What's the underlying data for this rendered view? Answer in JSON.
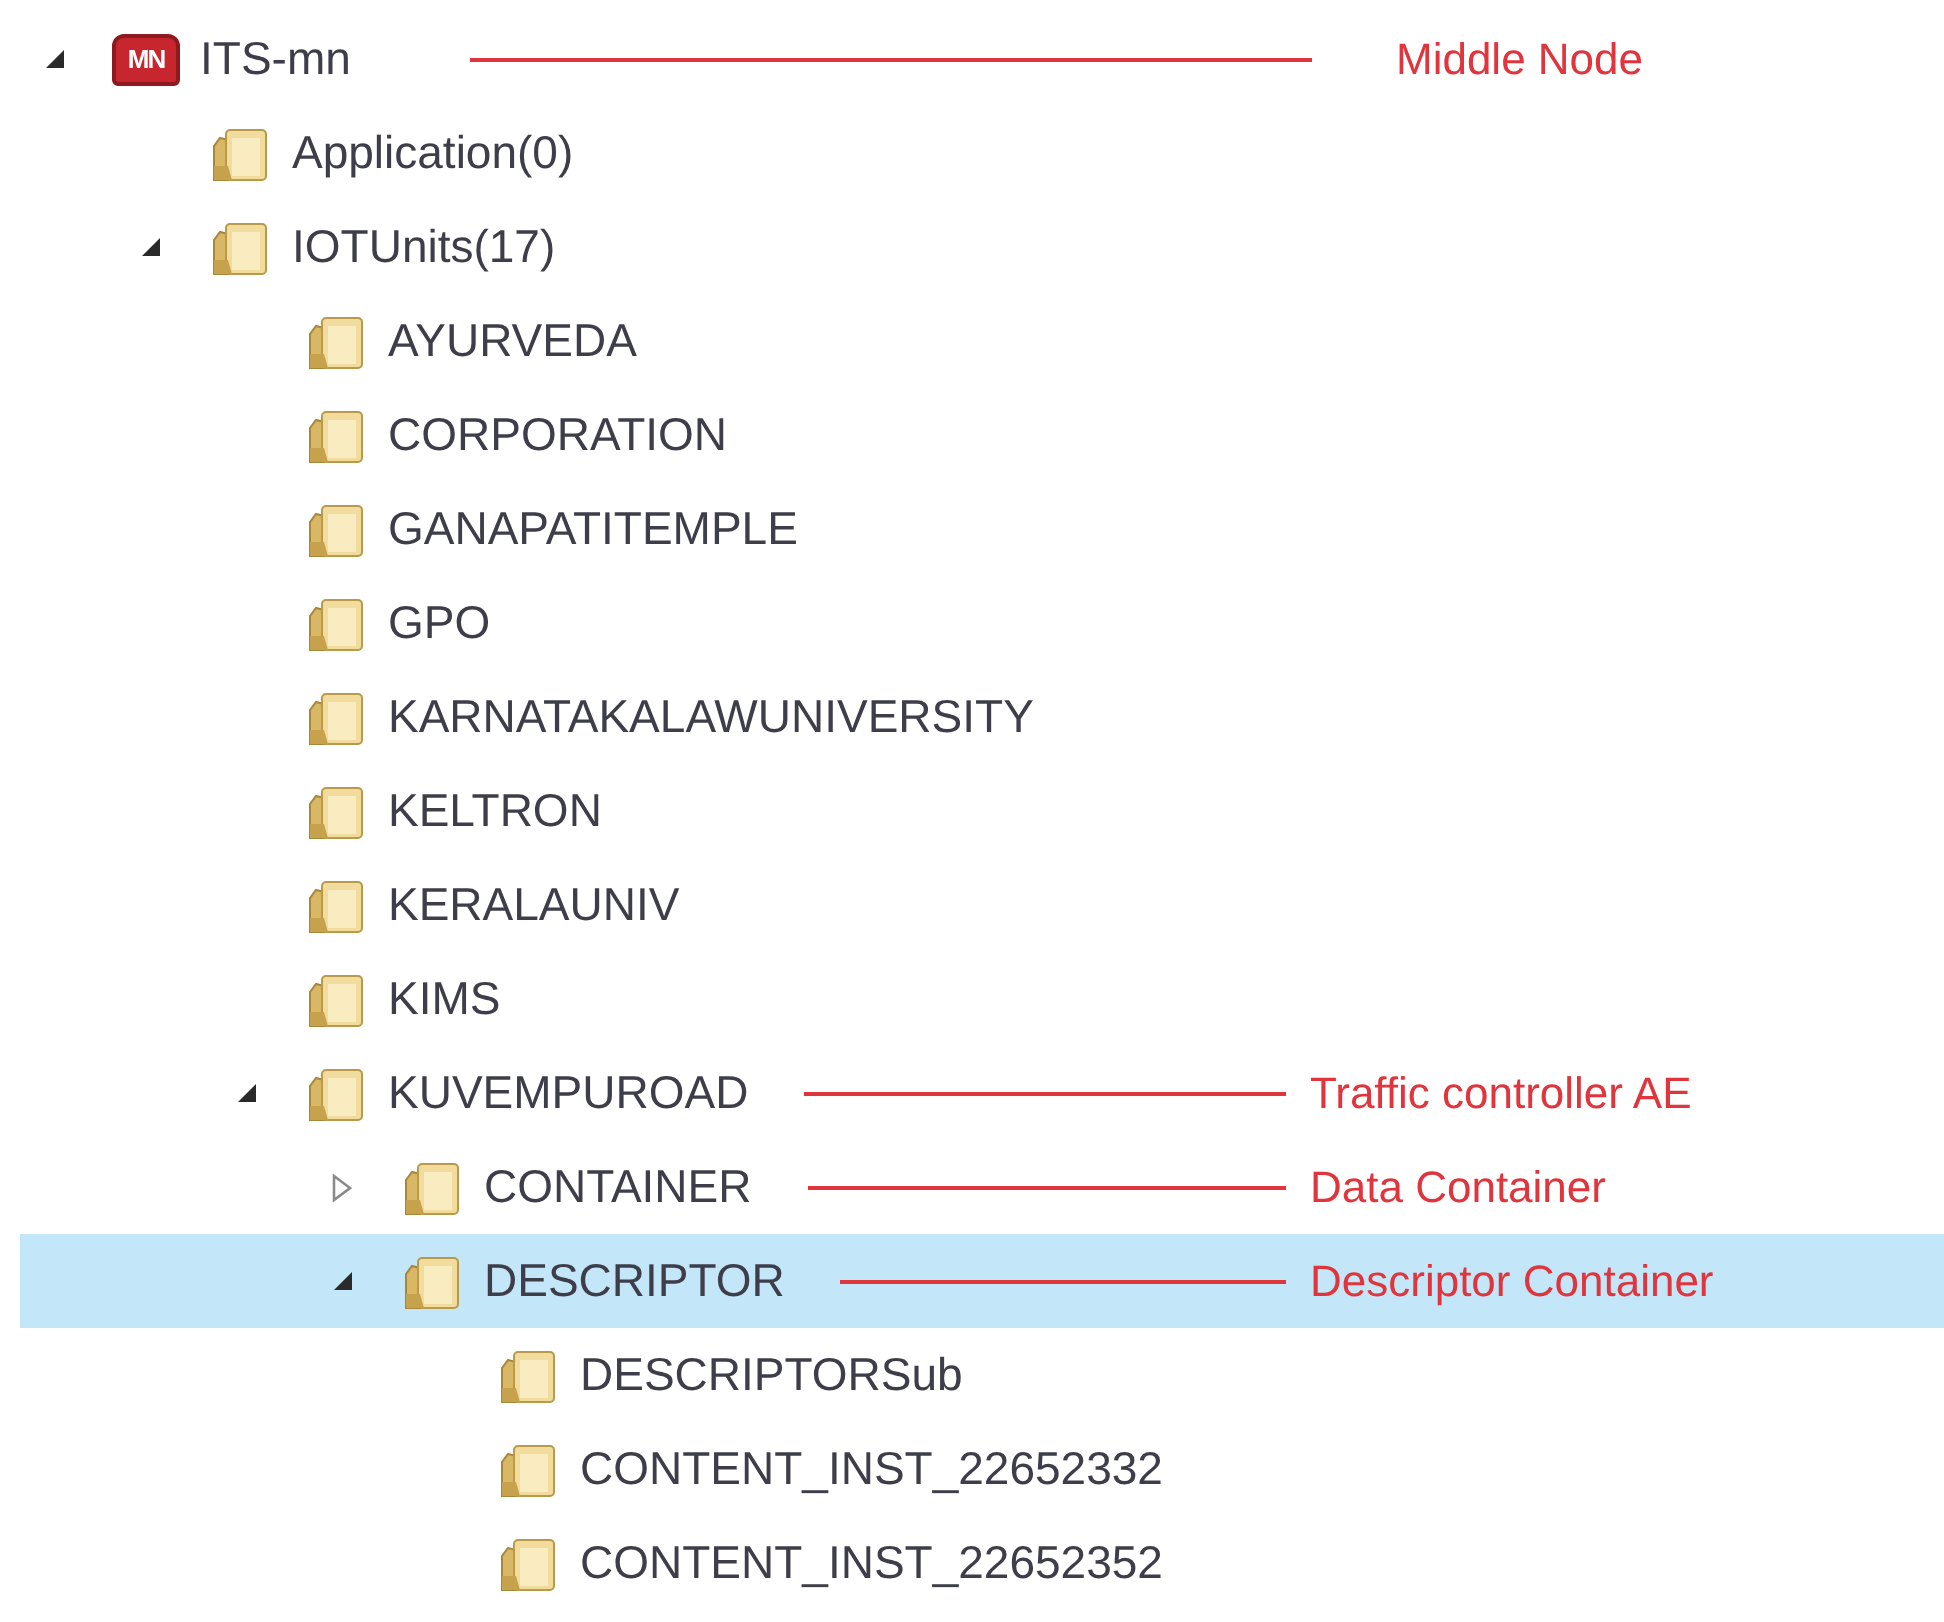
{
  "tree": [
    {
      "label": "ITS-mn",
      "kind": "node",
      "badge": "MN",
      "expanded": true,
      "selected": false,
      "annotation": "Middle Node",
      "children": [
        {
          "label": "Application(0)",
          "kind": "folder",
          "selected": false
        },
        {
          "label": "IOTUnits(17)",
          "kind": "folder",
          "expanded": true,
          "selected": false,
          "children": [
            {
              "label": "AYURVEDA",
              "kind": "folder",
              "selected": false
            },
            {
              "label": "CORPORATION",
              "kind": "folder",
              "selected": false
            },
            {
              "label": "GANAPATITEMPLE",
              "kind": "folder",
              "selected": false
            },
            {
              "label": "GPO",
              "kind": "folder",
              "selected": false
            },
            {
              "label": "KARNATAKALAWUNIVERSITY",
              "kind": "folder",
              "selected": false
            },
            {
              "label": "KELTRON",
              "kind": "folder",
              "selected": false
            },
            {
              "label": "KERALAUNIV",
              "kind": "folder",
              "selected": false
            },
            {
              "label": "KIMS",
              "kind": "folder",
              "selected": false
            },
            {
              "label": "KUVEMPUROAD",
              "kind": "folder",
              "expanded": true,
              "selected": false,
              "annotation": "Traffic controller AE",
              "children": [
                {
                  "label": "CONTAINER",
                  "kind": "folder",
                  "expanded": false,
                  "selected": false,
                  "annotation": "Data Container"
                },
                {
                  "label": "DESCRIPTOR",
                  "kind": "folder",
                  "expanded": true,
                  "selected": true,
                  "annotation": "Descriptor Container",
                  "children": [
                    {
                      "label": "DESCRIPTORSub",
                      "kind": "folder",
                      "selected": false
                    },
                    {
                      "label": "CONTENT_INST_22652332",
                      "kind": "folder",
                      "selected": false
                    },
                    {
                      "label": "CONTENT_INST_22652352",
                      "kind": "folder",
                      "selected": false
                    }
                  ]
                }
              ]
            }
          ]
        }
      ]
    }
  ]
}
